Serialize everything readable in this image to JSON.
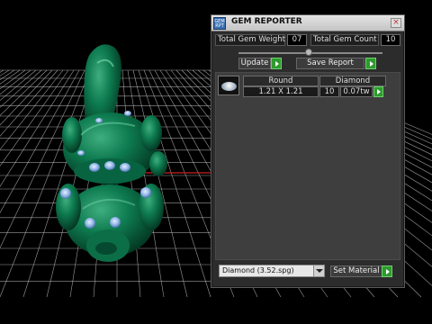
{
  "window": {
    "title": "GEM REPORTER",
    "icon_label": "GEM RPT",
    "close_glyph": "×"
  },
  "stats": {
    "weight_label": "Total Gem Weight",
    "weight_value": "07",
    "count_label": "Total Gem Count",
    "count_value": "10"
  },
  "actions": {
    "update_label": "Update",
    "save_report_label": "Save Report"
  },
  "gem_table": {
    "headers": [
      "Round",
      "Diamond"
    ],
    "row": {
      "size": "1.21 X 1.21",
      "count": "10",
      "weight": "0.07tw"
    }
  },
  "material": {
    "selected": "Diamond    (3.52.spg)",
    "set_label": "Set Material"
  },
  "colors": {
    "accent_go": "#2f9a2f",
    "model_green": "#0d7a4f",
    "gem_blue": "#8fb4e6",
    "grid": "#cfcfcf",
    "axis_red": "#cc2222"
  },
  "icons": [
    "app-icon",
    "close-icon",
    "play-arrow-icon",
    "gem-thumbnail",
    "dropdown-arrow-icon"
  ]
}
